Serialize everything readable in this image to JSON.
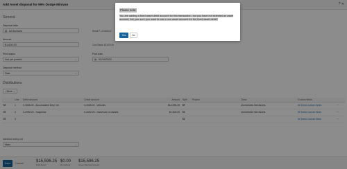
{
  "window": {
    "title": "Add Asset disposal for 99% Dodge Minivan"
  },
  "general": {
    "section_label": "General",
    "disposal_date_label": "Disposal date",
    "disposal_date_value": "02/16/2022",
    "retail_text": "Retail P...2/16/2022",
    "amount_label": "Amount",
    "amount_value": "$1,600.00",
    "cost_basis_text": "Cost Basis: $1,600.00",
    "print_status_label": "Print status",
    "print_status_value": "Not yet posted",
    "post_date_label": "Post date",
    "post_date_value": "02/16/2022",
    "disposal_method_label": "Disposal method",
    "disposal_method_value": "Sale"
  },
  "distributions": {
    "section_label": "Distributions",
    "move_button": "Move",
    "columns": [
      "",
      "Line",
      "Debit account",
      "Credit account",
      "Amount",
      "Split",
      "Project",
      "Class",
      "Custom fields",
      ""
    ],
    "rows": [
      {
        "line": "1",
        "debit": "0-1836-00 - Accumulated Depr Vel",
        "credit": "0-1535-00 - Vehicles",
        "amount": "$14,096.25",
        "split": "",
        "project": "",
        "class": "Unrestricted Net Assets",
        "custom": "Select custom fields"
      },
      {
        "line": "2",
        "debit": "0-2999-00 - Suspense",
        "credit": "0-4420-00 - Gain/Loss on Assets",
        "amount": "$1,500.00",
        "split": "",
        "project": "",
        "class": "Unrestricted Net Assets",
        "custom": "Select custom fields"
      },
      {
        "line": "3",
        "debit": "",
        "credit": "",
        "amount": "",
        "split": "",
        "project": "",
        "class": "",
        "custom": "Select custom fields"
      }
    ]
  },
  "interfund": {
    "label": "Interfund entry set",
    "value": "Main"
  },
  "footer": {
    "save": "Save",
    "cancel": "Cancel",
    "totals": [
      {
        "value": "$15,596.25",
        "label": "Distributed"
      },
      {
        "value": "$0.00",
        "label": "Remaining"
      },
      {
        "value": "$15,596.25",
        "label": "Asset disposal amount"
      }
    ]
  },
  "dialog": {
    "title": "Please note:",
    "message": "You are adding a fixed asset debit account for this transaction, but you have not selected an asset account. Are you sure you want to use a non asset account for the fixed asset debit?",
    "yes": "Yes",
    "no": "No"
  },
  "colors": {
    "primary": "#17639c",
    "link": "#1a6fb0"
  }
}
